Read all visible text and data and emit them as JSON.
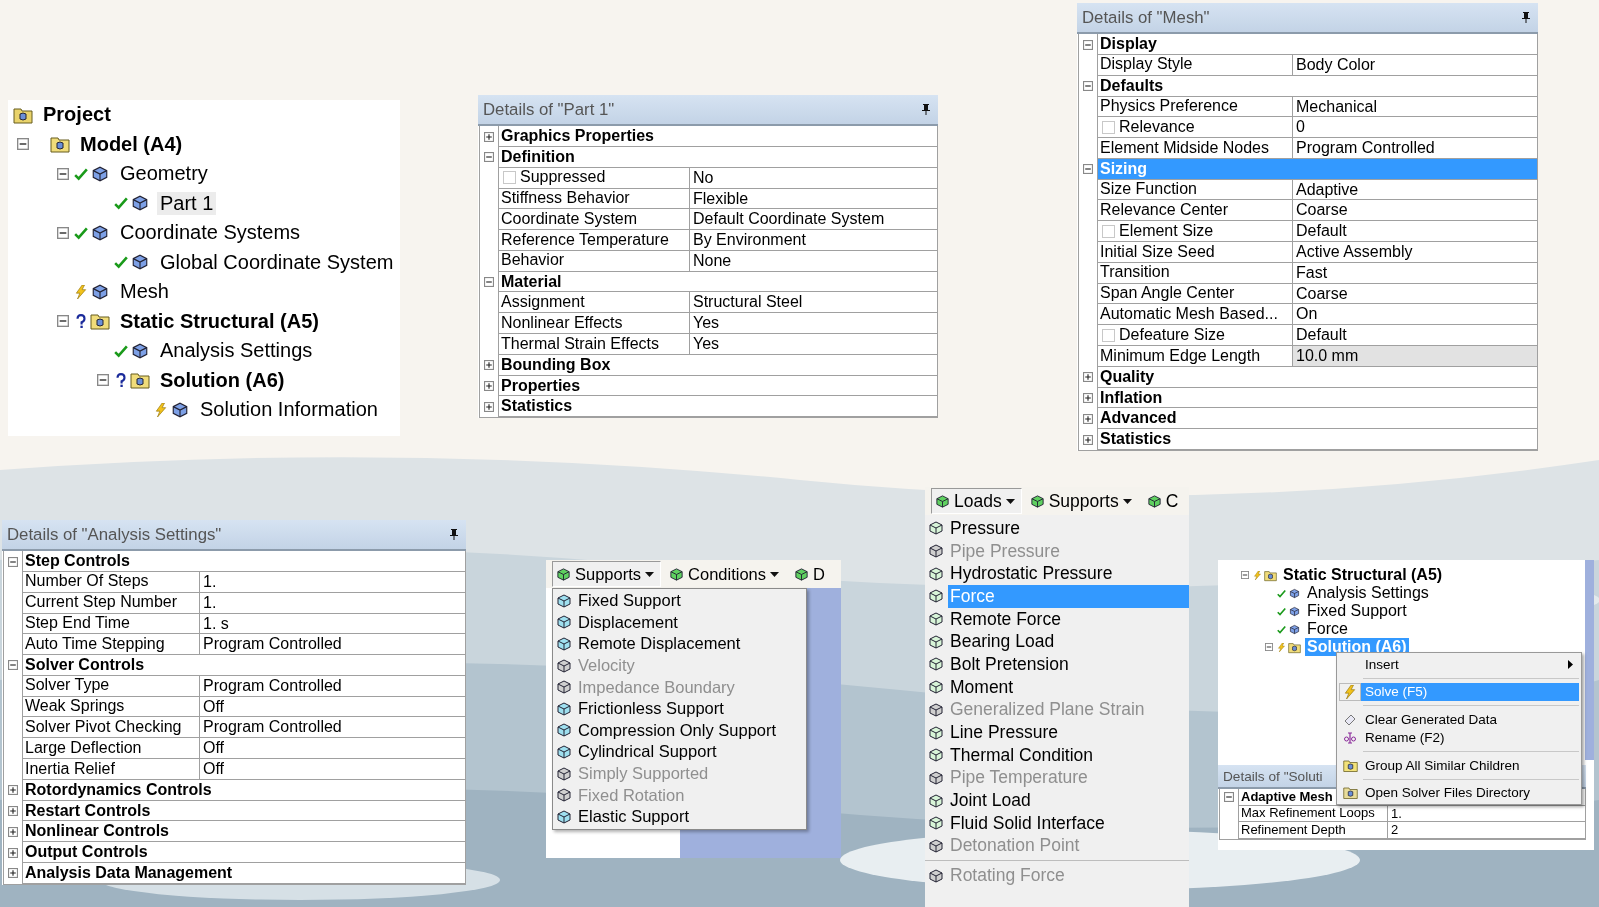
{
  "project_tree": {
    "root": {
      "label": "Project",
      "bold": true,
      "selected": false,
      "children": [
        {
          "label": "Model (A4)",
          "bold": true,
          "selected": false,
          "expanded": true,
          "children": [
            {
              "label": "Geometry",
              "bold": false,
              "kind": "ok",
              "selected": false,
              "expanded": true,
              "children": [
                {
                  "label": "Part 1",
                  "bold": false,
                  "kind": "ok",
                  "selected": true
                }
              ]
            },
            {
              "label": "Coordinate Systems",
              "bold": false,
              "kind": "ok",
              "selected": false,
              "expanded": true,
              "children": [
                {
                  "label": "Global Coordinate System",
                  "bold": false,
                  "kind": "ok",
                  "selected": false
                }
              ]
            },
            {
              "label": "Mesh",
              "bold": false,
              "kind": "update",
              "selected": false
            },
            {
              "label": "Static Structural (A5)",
              "bold": true,
              "kind": "undefined",
              "selected": false,
              "expanded": true,
              "children": [
                {
                  "label": "Analysis Settings",
                  "bold": false,
                  "kind": "ok",
                  "selected": false
                },
                {
                  "label": "Solution (A6)",
                  "bold": true,
                  "kind": "undefined",
                  "selected": false,
                  "expanded": true,
                  "children": [
                    {
                      "label": "Solution Information",
                      "bold": false,
                      "kind": "update",
                      "selected": false
                    }
                  ]
                }
              ]
            }
          ]
        }
      ]
    }
  },
  "part_details": {
    "title": "Details of \"Part 1\"",
    "groups": [
      {
        "label": "Graphics Properties",
        "expanded": false,
        "selected": false
      },
      {
        "label": "Definition",
        "expanded": true,
        "selected": false,
        "rows": [
          {
            "kind": "checkbox",
            "checked": false,
            "name": "Suppressed",
            "value": "No"
          },
          {
            "kind": "text",
            "name": "Stiffness Behavior",
            "value": "Flexible"
          },
          {
            "kind": "text",
            "name": "Coordinate System",
            "value": "Default Coordinate System"
          },
          {
            "kind": "text",
            "name": "Reference Temperature",
            "value": "By Environment"
          },
          {
            "kind": "text",
            "name": "Behavior",
            "value": "None"
          }
        ]
      },
      {
        "label": "Material",
        "expanded": true,
        "selected": false,
        "rows": [
          {
            "kind": "text",
            "name": "Assignment",
            "value": "Structural Steel"
          },
          {
            "kind": "text",
            "name": "Nonlinear Effects",
            "value": "Yes"
          },
          {
            "kind": "text",
            "name": "Thermal Strain Effects",
            "value": "Yes"
          }
        ]
      },
      {
        "label": "Bounding Box",
        "expanded": false,
        "selected": false
      },
      {
        "label": "Properties",
        "expanded": false,
        "selected": false
      },
      {
        "label": "Statistics",
        "expanded": false,
        "selected": false
      }
    ]
  },
  "mesh_details": {
    "title": "Details of \"Mesh\"",
    "groups": [
      {
        "label": "Display",
        "expanded": true,
        "selected": false,
        "rows": [
          {
            "kind": "text",
            "name": "Display Style",
            "value": "Body Color"
          }
        ]
      },
      {
        "label": "Defaults",
        "expanded": true,
        "selected": false,
        "rows": [
          {
            "kind": "text",
            "name": "Physics Preference",
            "value": "Mechanical"
          },
          {
            "kind": "checkbox",
            "checked": false,
            "name": "Relevance",
            "value": "0"
          },
          {
            "kind": "text",
            "name": "Element Midside Nodes",
            "value": "Program Controlled"
          }
        ]
      },
      {
        "label": "Sizing",
        "expanded": true,
        "selected": true,
        "rows": [
          {
            "kind": "text",
            "name": "Size Function",
            "value": "Adaptive"
          },
          {
            "kind": "text",
            "name": "Relevance Center",
            "value": "Coarse"
          },
          {
            "kind": "checkbox",
            "checked": false,
            "name": "Element Size",
            "value": "Default"
          },
          {
            "kind": "text",
            "name": "Initial Size Seed",
            "value": "Active Assembly"
          },
          {
            "kind": "text",
            "name": "Transition",
            "value": "Fast"
          },
          {
            "kind": "text",
            "name": "Span Angle Center",
            "value": "Coarse"
          },
          {
            "kind": "text",
            "name": "Automatic Mesh Based...",
            "value": "On"
          },
          {
            "kind": "checkbox",
            "checked": false,
            "name": "Defeature Size",
            "value": "Default"
          },
          {
            "kind": "readonly",
            "name": "Minimum Edge Length",
            "value": "10.0 mm"
          }
        ]
      },
      {
        "label": "Quality",
        "expanded": false,
        "selected": false
      },
      {
        "label": "Inflation",
        "expanded": false,
        "selected": false
      },
      {
        "label": "Advanced",
        "expanded": false,
        "selected": false
      },
      {
        "label": "Statistics",
        "expanded": false,
        "selected": false
      }
    ]
  },
  "analysis_details": {
    "title": "Details of \"Analysis Settings\"",
    "groups": [
      {
        "label": "Step Controls",
        "expanded": true,
        "selected": false,
        "rows": [
          {
            "kind": "text",
            "name": "Number Of Steps",
            "value": "1."
          },
          {
            "kind": "text",
            "name": "Current Step Number",
            "value": "1."
          },
          {
            "kind": "text",
            "name": "Step End Time",
            "value": "1. s"
          },
          {
            "kind": "text",
            "name": "Auto Time Stepping",
            "value": "Program Controlled"
          }
        ]
      },
      {
        "label": "Solver Controls",
        "expanded": true,
        "selected": false,
        "rows": [
          {
            "kind": "text",
            "name": "Solver Type",
            "value": "Program Controlled"
          },
          {
            "kind": "text",
            "name": "Weak Springs",
            "value": "Off"
          },
          {
            "kind": "text",
            "name": "Solver Pivot Checking",
            "value": "Program Controlled"
          },
          {
            "kind": "text",
            "name": "Large Deflection",
            "value": "Off"
          },
          {
            "kind": "text",
            "name": "Inertia Relief",
            "value": "Off"
          }
        ]
      },
      {
        "label": "Rotordynamics Controls",
        "expanded": false,
        "selected": false
      },
      {
        "label": "Restart Controls",
        "expanded": false,
        "selected": false
      },
      {
        "label": "Nonlinear Controls",
        "expanded": false,
        "selected": false
      },
      {
        "label": "Output Controls",
        "expanded": false,
        "selected": false
      },
      {
        "label": "Analysis Data Management",
        "expanded": false,
        "selected": false
      }
    ]
  },
  "supports_menu": {
    "toolbar": [
      {
        "label": "Supports",
        "dropdown": true,
        "selected": true
      },
      {
        "label": "Conditions",
        "dropdown": true,
        "selected": false
      },
      {
        "label": "D",
        "dropdown": false,
        "selected": false
      }
    ],
    "sections": [
      [
        {
          "label": "Fixed Support",
          "disabled": false,
          "selected": false
        },
        {
          "label": "Displacement",
          "disabled": false,
          "selected": false
        },
        {
          "label": "Remote Displacement",
          "disabled": false,
          "selected": false
        },
        {
          "label": "Velocity",
          "disabled": true,
          "selected": false
        },
        {
          "label": "Impedance Boundary",
          "disabled": true,
          "selected": false
        },
        {
          "label": "Frictionless Support",
          "disabled": false,
          "selected": false
        },
        {
          "label": "Compression Only Support",
          "disabled": false,
          "selected": false
        },
        {
          "label": "Cylindrical Support",
          "disabled": false,
          "selected": false
        },
        {
          "label": "Simply Supported",
          "disabled": true,
          "selected": false
        },
        {
          "label": "Fixed Rotation",
          "disabled": true,
          "selected": false
        },
        {
          "label": "Elastic Support",
          "disabled": false,
          "selected": false
        }
      ]
    ]
  },
  "loads_menu": {
    "toolbar": [
      {
        "label": "Loads",
        "dropdown": true,
        "selected": true
      },
      {
        "label": "Supports",
        "dropdown": true,
        "selected": false
      },
      {
        "label": "C",
        "dropdown": false,
        "selected": false
      }
    ],
    "sections": [
      [
        {
          "label": "Pressure",
          "disabled": false,
          "selected": false
        },
        {
          "label": "Pipe Pressure",
          "disabled": true,
          "selected": false
        },
        {
          "label": "Hydrostatic Pressure",
          "disabled": false,
          "selected": false
        },
        {
          "label": "Force",
          "disabled": false,
          "selected": true
        },
        {
          "label": "Remote Force",
          "disabled": false,
          "selected": false
        },
        {
          "label": "Bearing Load",
          "disabled": false,
          "selected": false
        },
        {
          "label": "Bolt Pretension",
          "disabled": false,
          "selected": false
        },
        {
          "label": "Moment",
          "disabled": false,
          "selected": false
        },
        {
          "label": "Generalized Plane Strain",
          "disabled": true,
          "selected": false
        },
        {
          "label": "Line Pressure",
          "disabled": false,
          "selected": false
        },
        {
          "label": "Thermal Condition",
          "disabled": false,
          "selected": false
        },
        {
          "label": "Pipe Temperature",
          "disabled": true,
          "selected": false
        },
        {
          "label": "Joint Load",
          "disabled": false,
          "selected": false
        },
        {
          "label": "Fluid Solid Interface",
          "disabled": false,
          "selected": false
        },
        {
          "label": "Detonation Point",
          "disabled": true,
          "selected": false
        }
      ],
      [
        {
          "label": "Rotating Force",
          "disabled": true,
          "selected": false
        }
      ]
    ]
  },
  "solve_view": {
    "tree": {
      "root": {
        "label": "Static Structural (A5)",
        "bold": true,
        "kind": "update",
        "selected": false,
        "expanded": true,
        "children": [
          {
            "label": "Analysis Settings",
            "bold": false,
            "kind": "ok",
            "selected": false
          },
          {
            "label": "Fixed Support",
            "bold": false,
            "kind": "ok",
            "selected": false
          },
          {
            "label": "Force",
            "bold": false,
            "kind": "ok",
            "selected": false
          },
          {
            "label": "Solution (A6)",
            "bold": true,
            "kind": "update",
            "selected": true,
            "expanded": true
          }
        ]
      }
    },
    "details": {
      "title": "Details of \"Soluti",
      "groups": [
        {
          "label": "Adaptive Mesh",
          "expanded": true,
          "selected": false,
          "rows": [
            {
              "kind": "text",
              "name": "Max Refinement Loops",
              "value": "1."
            },
            {
              "kind": "text",
              "name": "Refinement Depth",
              "value": "2"
            }
          ]
        }
      ]
    },
    "context_menu": {
      "sections": [
        [
          {
            "label": "Insert",
            "submenu": true,
            "selected": false
          }
        ],
        [
          {
            "label": "Solve (F5)",
            "submenu": false,
            "selected": true
          }
        ],
        [
          {
            "label": "Clear Generated Data",
            "submenu": false,
            "selected": false
          },
          {
            "label": "Rename (F2)",
            "submenu": false,
            "selected": false
          }
        ],
        [
          {
            "label": "Group All Similar Children",
            "submenu": false,
            "selected": false
          }
        ],
        [
          {
            "label": "Open Solver Files Directory",
            "submenu": false,
            "selected": false
          }
        ]
      ]
    }
  }
}
